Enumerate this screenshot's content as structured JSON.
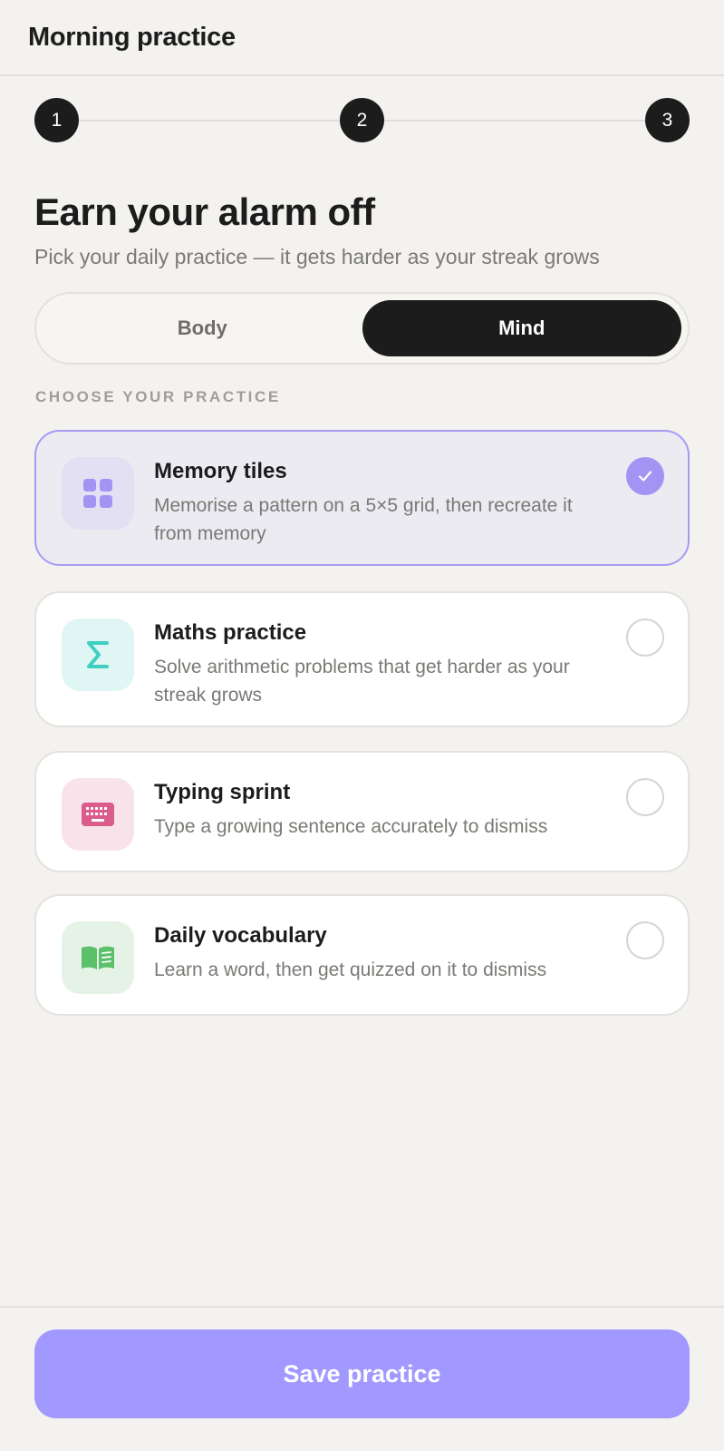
{
  "header": {
    "title": "Morning practice"
  },
  "stepper": {
    "steps": [
      "1",
      "2",
      "3"
    ]
  },
  "main": {
    "title": "Earn your alarm off",
    "subtitle": "Pick your daily practice — it gets harder as your streak grows"
  },
  "segments": {
    "body": "Body",
    "mind": "Mind",
    "selected": "Mind"
  },
  "section_label": "CHOOSE YOUR PRACTICE",
  "practices": [
    {
      "title": "Memory tiles",
      "desc": "Memorise a pattern on a 5×5 grid, then recreate it from memory",
      "icon": "grid-icon",
      "selected": true
    },
    {
      "title": "Maths practice",
      "desc": "Solve arithmetic problems that get harder as your streak grows",
      "icon": "sigma-icon",
      "selected": false
    },
    {
      "title": "Typing sprint",
      "desc": "Type a growing sentence accurately to dismiss",
      "icon": "keyboard-icon",
      "selected": false
    },
    {
      "title": "Daily vocabulary",
      "desc": "Learn a word, then get quizzed on it to dismiss",
      "icon": "book-icon",
      "selected": false
    }
  ],
  "footer": {
    "save_label": "Save practice"
  },
  "colors": {
    "accent": "#a394f4",
    "button": "#a199ff",
    "dark": "#1c1c1c",
    "background": "#f3f2ef"
  }
}
